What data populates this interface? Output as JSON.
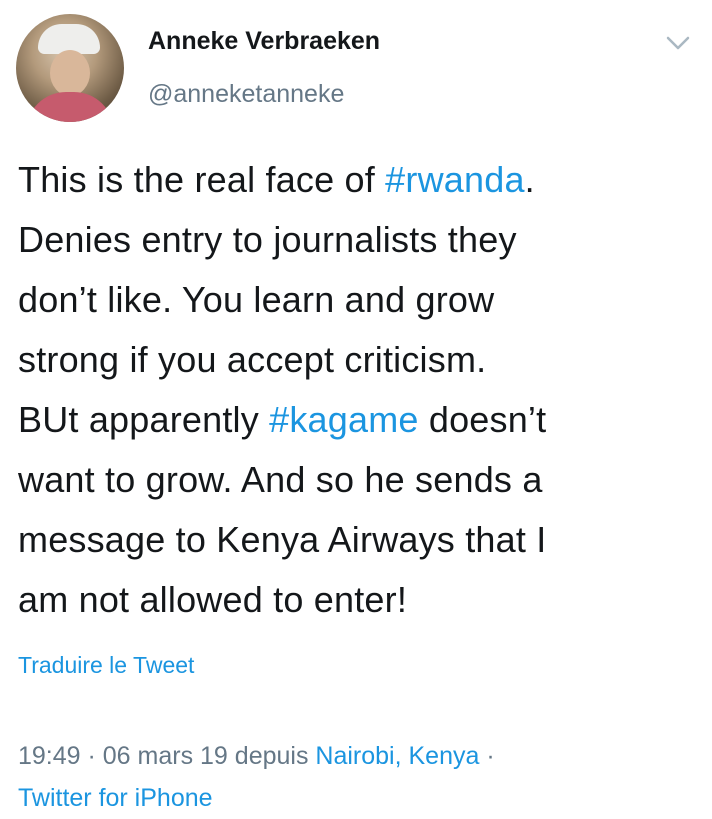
{
  "user": {
    "name": "Anneke Verbraeken",
    "handle": "@anneketanneke"
  },
  "icons": {
    "avatar": "profile-photo",
    "menu": "chevron-down-icon"
  },
  "tweet": {
    "lines": [
      {
        "a": "This is the real face of ",
        "tag": "#rwanda",
        "b": "."
      },
      {
        "a": "Denies entry to journalists they"
      },
      {
        "a": "don’t like. You learn and grow"
      },
      {
        "a": "strong if you accept criticism."
      },
      {
        "a": "BUt apparently ",
        "tag": "#kagame",
        "b": " doesn’t"
      },
      {
        "a": "want to grow. And so he sends a"
      },
      {
        "a": "message to Kenya Airways that I"
      },
      {
        "a": "am not allowed to enter!"
      }
    ]
  },
  "translate_label": "Traduire le Tweet",
  "meta": {
    "time_date": "19:49 · 06 mars 19 depuis ",
    "location": "Nairobi, Kenya",
    "separator": " ·",
    "source": "Twitter for iPhone"
  },
  "colors": {
    "link": "#1b95e0",
    "muted": "#657786",
    "text": "#14171a"
  }
}
